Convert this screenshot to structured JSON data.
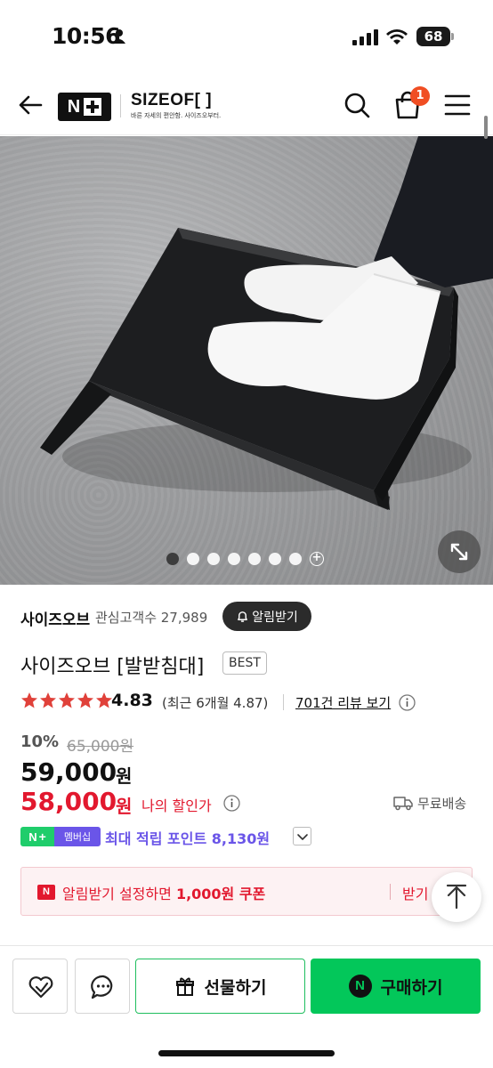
{
  "status_bar": {
    "time": "10:56",
    "battery": "68"
  },
  "header": {
    "brand_name": "SIZEOF[ ]",
    "brand_tagline": "바른 자세의 편안함. 사이즈오부터.",
    "cart_count": "1"
  },
  "gallery": {
    "dot_count": 7,
    "active_index": 0,
    "more_symbol": "+"
  },
  "store": {
    "name": "사이즈오브",
    "followers_label": "관심고객수 27,989",
    "alert_button_label": "알림받기"
  },
  "product": {
    "title": "사이즈오브 [발받침대]",
    "badge": "BEST",
    "rating_value": "4.83",
    "rating_stars": 5,
    "rating_recent": "(최근 6개월 4.87)",
    "review_link": "701건 리뷰 보기",
    "discount_rate": "10%",
    "original_price": "65,000원",
    "sale_price": "59,000",
    "sale_price_unit": "원",
    "my_price": "58,000",
    "my_price_unit": "원",
    "my_price_label": "나의 할인가",
    "shipping_label": "무료배송"
  },
  "membership": {
    "badge_label": "멤버십",
    "points_text": "최대 적립 포인트 8,130원"
  },
  "coupon": {
    "text_prefix": "알림받기 설정하면 ",
    "text_bold": "1,000원 쿠폰",
    "get_label": "받기"
  },
  "bottom_bar": {
    "gift_label": "선물하기",
    "buy_label": "구매하기"
  },
  "colors": {
    "accent_green": "#03c75a",
    "price_red": "#e2182e",
    "membership_purple": "#6a55e8",
    "star_red": "#e0413a",
    "cart_badge": "#f04e23"
  }
}
